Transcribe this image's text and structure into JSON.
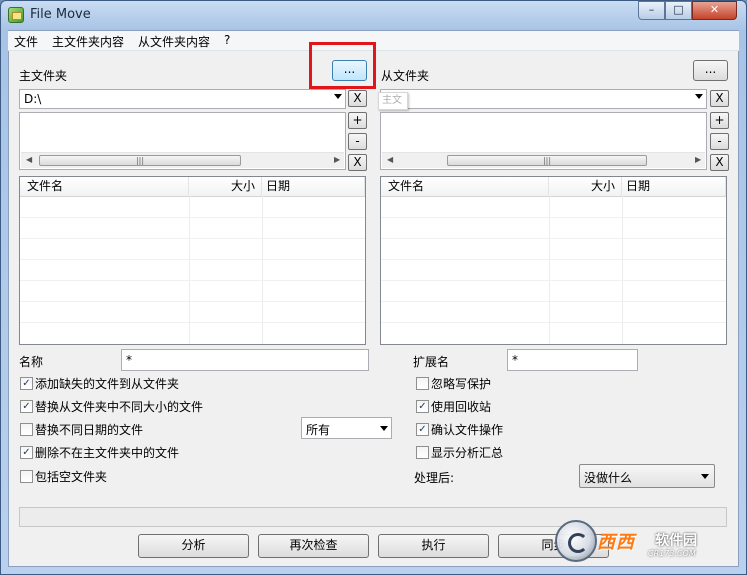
{
  "window": {
    "title": "File Move",
    "min_label": "–",
    "max_label": "□",
    "close_label": "✕"
  },
  "menu": [
    "文件",
    "主文件夹内容",
    "从文件夹内容",
    "?"
  ],
  "master": {
    "label": "主文件夹",
    "browse_label": "...",
    "path": "D:\\",
    "clear_label": "X",
    "add_label": "+",
    "remove_label": "-",
    "x_label": "X",
    "columns": [
      "文件名",
      "大小",
      "日期"
    ]
  },
  "slave": {
    "label": "从文件夹",
    "browse_label": "...",
    "path": "",
    "clear_label": "X",
    "add_label": "+",
    "remove_label": "-",
    "x_label": "X",
    "columns": [
      "文件名",
      "大小",
      "日期"
    ]
  },
  "filters": {
    "name_label": "名称",
    "name_value": "*",
    "ext_label": "扩展名",
    "ext_value": "*"
  },
  "options_left": [
    {
      "label": "添加缺失的文件到从文件夹",
      "checked": true
    },
    {
      "label": "替换从文件夹中不同大小的文件",
      "checked": true
    },
    {
      "label": "替换不同日期的文件",
      "checked": false
    },
    {
      "label": "删除不在主文件夹中的文件",
      "checked": true
    },
    {
      "label": "包括空文件夹",
      "checked": false
    }
  ],
  "date_filter": {
    "selected": "所有"
  },
  "options_right": [
    {
      "label": "忽略写保护",
      "checked": false
    },
    {
      "label": "使用回收站",
      "checked": true
    },
    {
      "label": "确认文件操作",
      "checked": true
    },
    {
      "label": "显示分析汇总",
      "checked": false
    }
  ],
  "after": {
    "label": "处理后:",
    "selected": "没做什么"
  },
  "buttons": {
    "analyze": "分析",
    "recheck": "再次检查",
    "execute": "执行",
    "sync": "同步"
  },
  "watermark": {
    "main": "西西",
    "brand": "软件园",
    "sub": "CR173.COM"
  },
  "tooltip_text": "主文"
}
